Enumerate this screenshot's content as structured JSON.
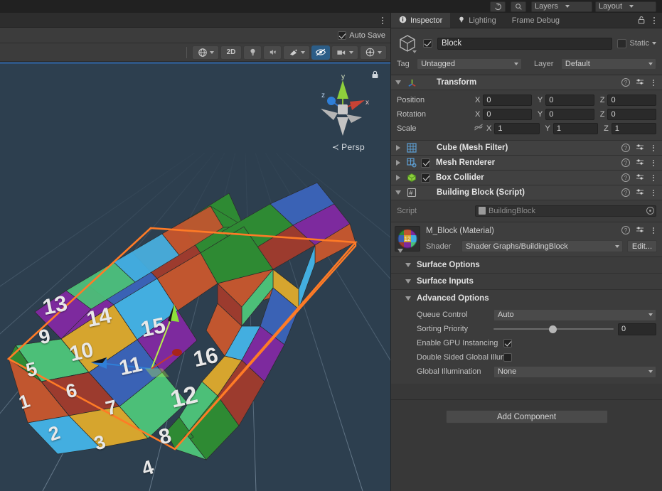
{
  "appbar": {
    "history_icon": "history-icon",
    "search_icon": "search-icon",
    "layers_label": "Layers",
    "layout_label": "Layout"
  },
  "scene": {
    "autosave_label": "Auto Save",
    "autosave_checked": true,
    "toolbar": [
      {
        "name": "draw-mode-dropdown",
        "label": "",
        "icon": "shaded-globe-icon",
        "dropdown": true,
        "active": false
      },
      {
        "name": "toggle-2d",
        "label": "2D",
        "icon": "",
        "dropdown": false,
        "active": false
      },
      {
        "name": "toggle-scene-lighting",
        "label": "",
        "icon": "light-bulb-icon",
        "dropdown": false,
        "active": false
      },
      {
        "name": "toggle-audio",
        "label": "",
        "icon": "audio-mute-icon",
        "dropdown": false,
        "active": false
      },
      {
        "name": "fx-dropdown",
        "label": "",
        "icon": "fx-icon",
        "dropdown": true,
        "active": false
      },
      {
        "name": "scene-visibility-toggle",
        "label": "",
        "icon": "eye-crossed-icon",
        "dropdown": false,
        "active": true
      },
      {
        "name": "camera-dropdown",
        "label": "",
        "icon": "camera-icon",
        "dropdown": true,
        "active": false
      },
      {
        "name": "gizmos-dropdown",
        "label": "",
        "icon": "gizmos-icon",
        "dropdown": true,
        "active": false
      }
    ],
    "gizmo": {
      "y_label": "y",
      "x_label": "x",
      "z_label": "z",
      "projection_label": "Persp",
      "lock_icon": "lock-icon"
    },
    "background_color": "#2d3f4f",
    "selection_outline_color": "#ff7b26",
    "object": {
      "name": "Block",
      "grid_cols": 4,
      "grid_rows": 4,
      "top_face_tiles": [
        {
          "n": 13,
          "color": "#7d2a9e"
        },
        {
          "n": 14,
          "color": "#3a62b5"
        },
        {
          "n": 15,
          "color": "#9c3b2e"
        },
        {
          "n": 16,
          "color": "#2e8a33"
        },
        {
          "n": 9,
          "color": "#4cbf78"
        },
        {
          "n": 10,
          "color": "#d6a52e"
        },
        {
          "n": 11,
          "color": "#43aee0"
        },
        {
          "n": 12,
          "color": "#c1562f"
        },
        {
          "n": 5,
          "color": "#2e8a33"
        },
        {
          "n": 6,
          "color": "#9c3b2e"
        },
        {
          "n": 7,
          "color": "#3a62b5"
        },
        {
          "n": 8,
          "color": "#7d2a9e"
        },
        {
          "n": 1,
          "color": "#c1562f"
        },
        {
          "n": 2,
          "color": "#43aee0"
        },
        {
          "n": 3,
          "color": "#d6a52e"
        },
        {
          "n": 4,
          "color": "#4cbf78"
        }
      ]
    }
  },
  "inspector": {
    "tabs": [
      {
        "label": "Inspector",
        "icon": "info-icon",
        "selected": true
      },
      {
        "label": "Lighting",
        "icon": "light-bulb-icon",
        "selected": false
      },
      {
        "label": "Frame Debug",
        "icon": "",
        "selected": false
      }
    ],
    "lock_icon": "lock-icon",
    "menu_icon": "kebab-menu-icon",
    "object": {
      "enabled": true,
      "name": "Block",
      "static_label": "Static",
      "static_checked": false,
      "tag_label": "Tag",
      "tag_value": "Untagged",
      "layer_label": "Layer",
      "layer_value": "Default"
    },
    "transform": {
      "title": "Transform",
      "rows": [
        {
          "label": "Position",
          "x": "0",
          "y": "0",
          "z": "0",
          "link": false
        },
        {
          "label": "Rotation",
          "x": "0",
          "y": "0",
          "z": "0",
          "link": false
        },
        {
          "label": "Scale",
          "x": "1",
          "y": "1",
          "z": "1",
          "link": true
        }
      ],
      "axis_labels": [
        "X",
        "Y",
        "Z"
      ]
    },
    "components": [
      {
        "title": "Cube (Mesh Filter)",
        "icon": "mesh-filter-icon",
        "expanded": false,
        "has_checkbox": false,
        "checked": false
      },
      {
        "title": "Mesh Renderer",
        "icon": "mesh-renderer-icon",
        "expanded": false,
        "has_checkbox": true,
        "checked": true
      },
      {
        "title": "Box Collider",
        "icon": "box-collider-icon",
        "expanded": false,
        "has_checkbox": true,
        "checked": true
      },
      {
        "title": "Building Block (Script)",
        "icon": "script-icon",
        "expanded": true,
        "has_checkbox": false,
        "checked": false
      }
    ],
    "script_row": {
      "label": "Script",
      "value": "BuildingBlock"
    },
    "material": {
      "name": "M_Block (Material)",
      "shader_label": "Shader",
      "shader_value": "Shader Graphs/BuildingBlock",
      "edit_label": "Edit...",
      "sections": [
        "Surface Options",
        "Surface Inputs",
        "Advanced Options"
      ],
      "advanced": {
        "queue_control_label": "Queue Control",
        "queue_control_value": "Auto",
        "sorting_priority_label": "Sorting Priority",
        "sorting_priority_value": "0",
        "gpu_instancing_label": "Enable GPU Instancing",
        "gpu_instancing_checked": true,
        "double_sided_label": "Double Sided Global Illumination",
        "double_sided_checked": false,
        "global_illum_label": "Global Illumination",
        "global_illum_value": "None"
      }
    },
    "add_component_label": "Add Component"
  }
}
